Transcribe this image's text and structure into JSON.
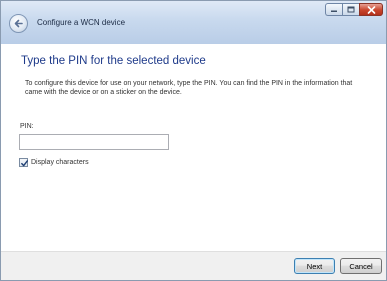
{
  "window": {
    "title": "Configure a WCN device",
    "controls": [
      "minimize-icon",
      "maximize-icon",
      "close-icon"
    ],
    "back_icon": "back-arrow-icon"
  },
  "main": {
    "heading": "Type the PIN for the selected device",
    "description": "To configure this device for use on your network, type the PIN. You can find the PIN in the information that came with the device or on a sticker on the device.",
    "pin_label": "PIN:",
    "pin_value": "",
    "display_characters_label": "Display characters",
    "display_characters_checked": true
  },
  "footer": {
    "next_label": "Next",
    "cancel_label": "Cancel"
  },
  "colors": {
    "heading": "#1e3a8a",
    "titlebar": "#c8d9ee",
    "close_button": "#c9452c"
  }
}
